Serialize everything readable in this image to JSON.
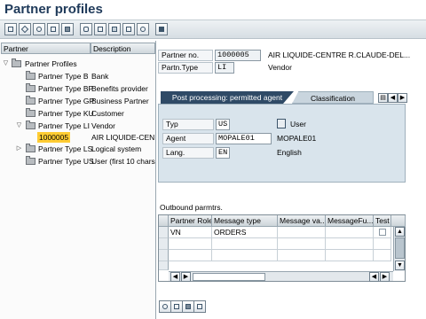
{
  "window": {
    "title": "Partner profiles"
  },
  "toolbar": {
    "icons": [
      "new-icon",
      "edit-icon",
      "display-icon",
      "copy-icon",
      "delete-icon",
      "check-icon",
      "print-icon",
      "export-icon",
      "layout-icon",
      "settings-icon",
      "help-icon"
    ]
  },
  "tree": {
    "col_partner": "Partner",
    "col_description": "Description",
    "root": "Partner Profiles",
    "items": [
      {
        "label": "Partner Type B",
        "desc": "Bank"
      },
      {
        "label": "Partner Type BP",
        "desc": "Benefits provider"
      },
      {
        "label": "Partner Type GP",
        "desc": "Business Partner"
      },
      {
        "label": "Partner Type KU",
        "desc": "Customer"
      },
      {
        "label": "Partner Type LI",
        "desc": "Vendor"
      },
      {
        "label": "1000005",
        "desc": "AIR LIQUIDE-CEN"
      },
      {
        "label": "Partner Type LS",
        "desc": "Logical system"
      },
      {
        "label": "Partner Type US",
        "desc": "User (first 10 chars"
      }
    ]
  },
  "header": {
    "partner_no_label": "Partner no.",
    "partner_no": "1000005",
    "partner_name": "AIR LIQUIDE-CENTRE R.CLAUDE-DEL...",
    "partn_type_label": "Partn.Type",
    "partn_type": "LI",
    "partn_type_desc": "Vendor"
  },
  "tabs": {
    "active": "Post processing: permitted agent",
    "inactive": "Classification"
  },
  "agent": {
    "typ_label": "Typ",
    "typ": "US",
    "typ_desc": "User",
    "agent_label": "Agent",
    "agent": "MOPALE01",
    "agent_desc": "MOPALE01",
    "lang_label": "Lang.",
    "lang": "EN",
    "lang_desc": "English"
  },
  "outbound": {
    "title": "Outbound parmtrs.",
    "columns": [
      "Partner Role",
      "Message type",
      "Message va...",
      "MessageFu...",
      "Test"
    ],
    "rows": [
      {
        "role": "VN",
        "msgtype": "ORDERS"
      }
    ]
  },
  "colors": {
    "title": "#1f3a5a",
    "highlight": "#ffcc33",
    "tab_active": "#2f4a66",
    "panel": "#d9e4ec"
  }
}
